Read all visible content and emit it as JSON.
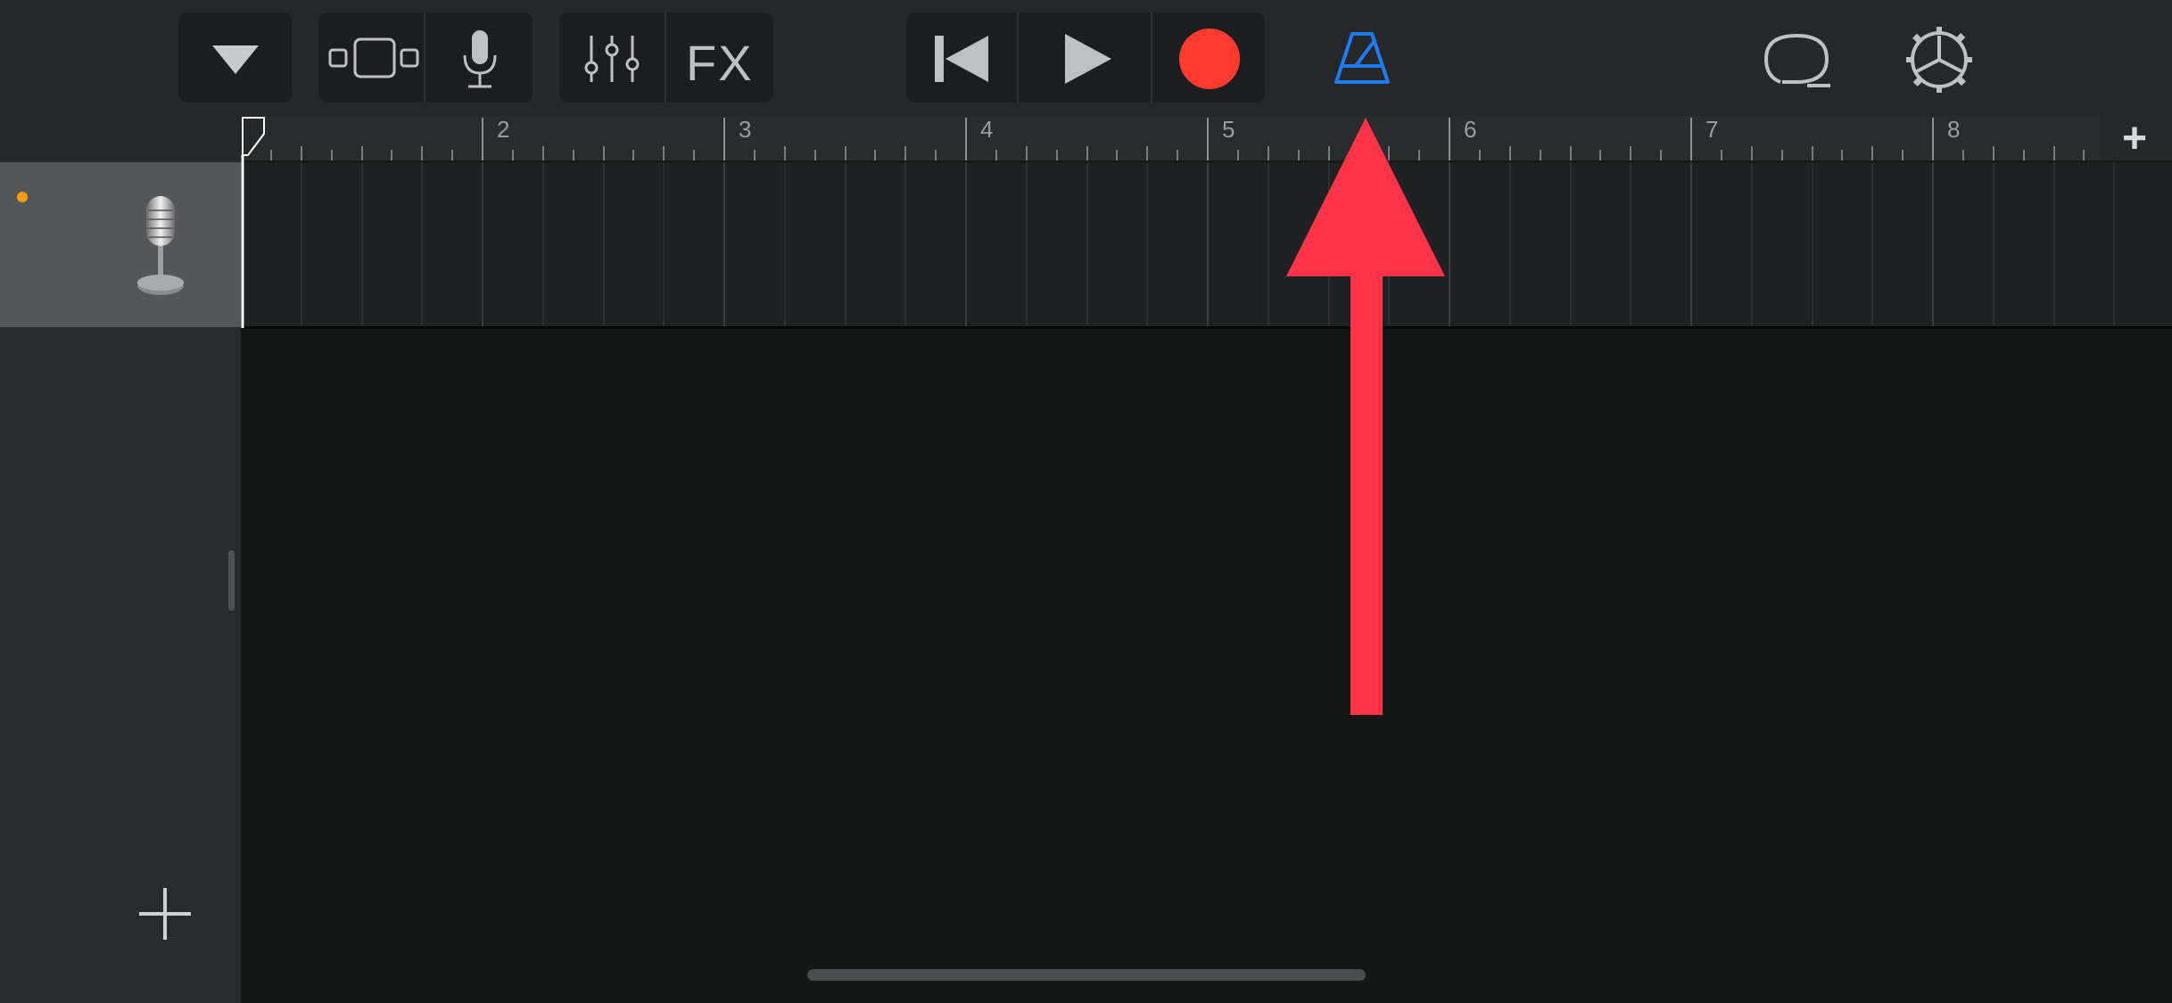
{
  "toolbar": {
    "browser_icon": "triangle-down-icon",
    "view_icon": "tracks-view-icon",
    "instrument_icon": "microphone-icon",
    "mixer_icon": "sliders-icon",
    "fx_label": "FX",
    "rewind_icon": "go-to-beginning-icon",
    "play_icon": "play-icon",
    "record_icon": "record-icon",
    "metronome_icon": "metronome-icon",
    "loop_icon": "loop-browser-icon",
    "settings_icon": "gear-icon"
  },
  "ruler": {
    "bar_numbers": [
      "2",
      "3",
      "4",
      "5",
      "6",
      "7",
      "8"
    ],
    "add_section_label": "+"
  },
  "track": {
    "icon": "vintage-microphone-icon"
  },
  "sidebar": {
    "add_track_label": "+"
  },
  "annotation": {
    "arrow_icon": "red-up-arrow-icon"
  },
  "colors": {
    "toolbar_bg": "#262728",
    "button_bg": "#1c1d1e",
    "icon_gray": "#bfc0c1",
    "record_red": "#ff3b30",
    "metronome_blue": "#1e7cf2",
    "arrow_red": "#ff3347",
    "playhead_white": "#ffffff",
    "track_indicator_orange": "#f39c12"
  }
}
